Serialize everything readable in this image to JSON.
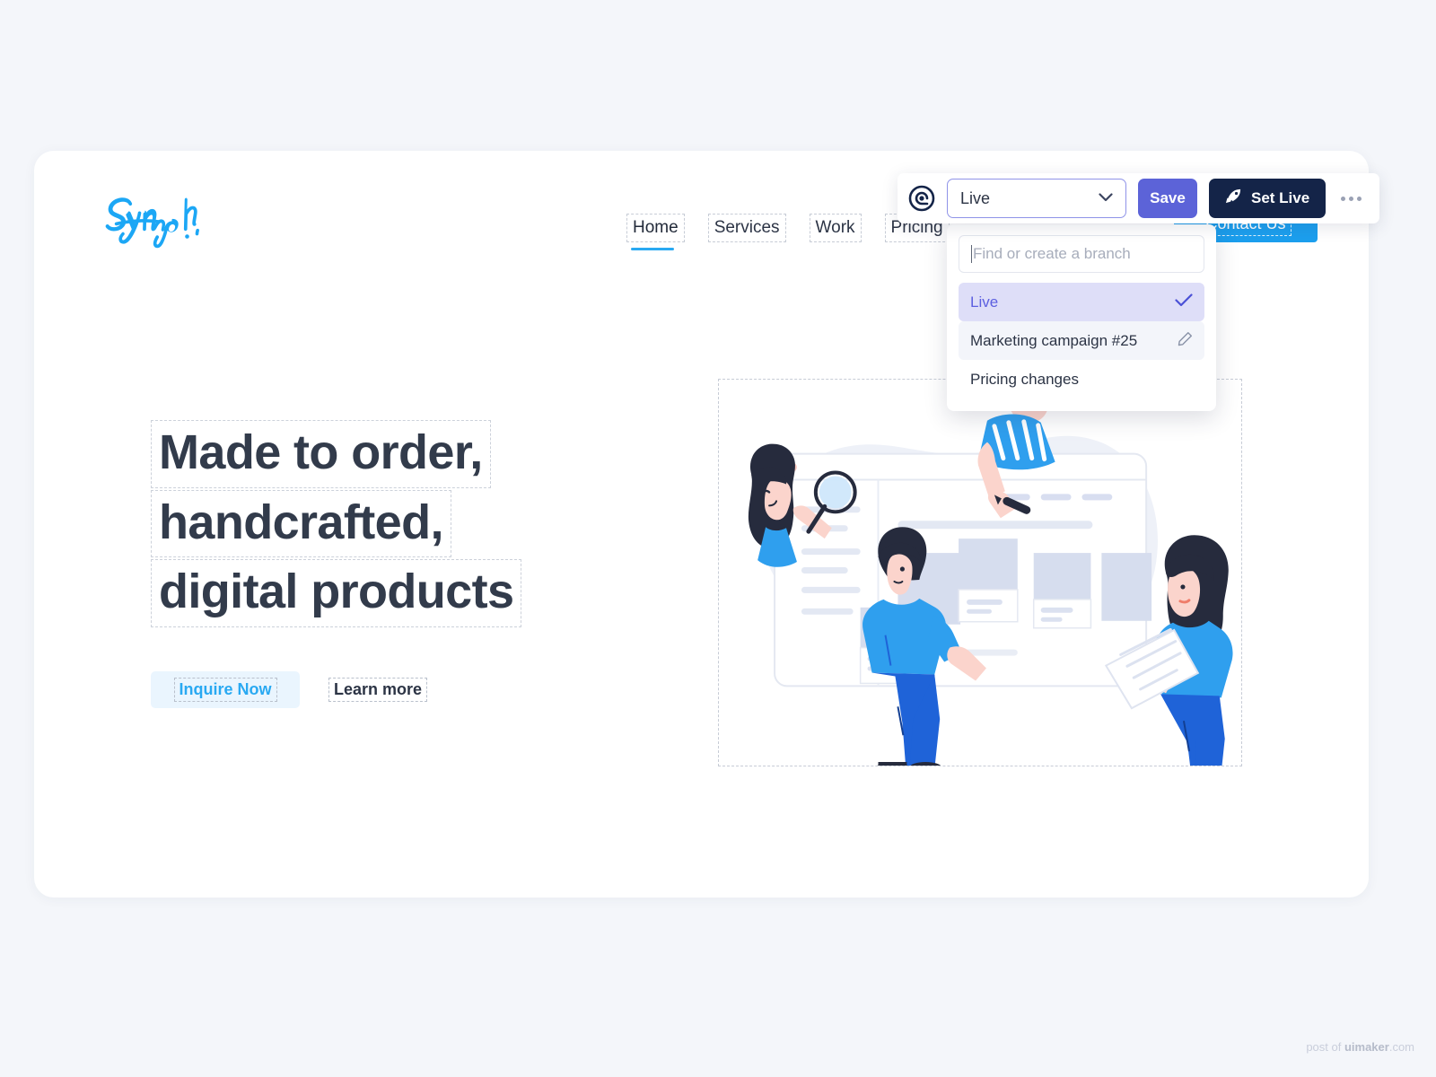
{
  "page": {
    "background_color": "#f4f6fa",
    "watermark_prefix": "post of ",
    "watermark_brand": "uimaker",
    "watermark_suffix": ".com"
  },
  "site": {
    "brand": {
      "name": "Symph",
      "logo_color": "#1ca7f5"
    },
    "nav": [
      {
        "label": "Home",
        "active": true
      },
      {
        "label": "Services",
        "active": false
      },
      {
        "label": "Work",
        "active": false
      },
      {
        "label": "Pricing",
        "active": false
      }
    ],
    "contact_button": {
      "label": "Contact Us",
      "color": "#1c9fee"
    },
    "hero": {
      "headline_lines": [
        "Made to order,",
        "handcrafted,",
        "digital products"
      ],
      "primary_cta": {
        "label": "Inquire Now",
        "text_color": "#29a9f2",
        "bg_color": "#eaf5fe"
      },
      "secondary_cta": {
        "label": "Learn more",
        "text_color": "#2c3445"
      }
    },
    "illustration": {
      "name": "team-collaboration-wireframe-illustration"
    }
  },
  "editor": {
    "app_icon": "target-spiral-icon",
    "branch_select": {
      "value": "Live",
      "icon": "chevron-down-icon"
    },
    "save_button": {
      "label": "Save",
      "color": "#5c63d8"
    },
    "set_live_button": {
      "label": "Set Live",
      "icon": "rocket-icon",
      "color": "#142448"
    },
    "more_button": {
      "icon": "ellipsis-icon"
    },
    "dropdown": {
      "search_placeholder": "Find or create a branch",
      "search_value": "",
      "branches": [
        {
          "label": "Live",
          "state": "selected",
          "trailing_icon": "check-icon"
        },
        {
          "label": "Marketing campaign #25",
          "state": "hovered",
          "trailing_icon": "pencil-icon"
        },
        {
          "label": "Pricing changes",
          "state": "default",
          "trailing_icon": ""
        }
      ]
    }
  }
}
